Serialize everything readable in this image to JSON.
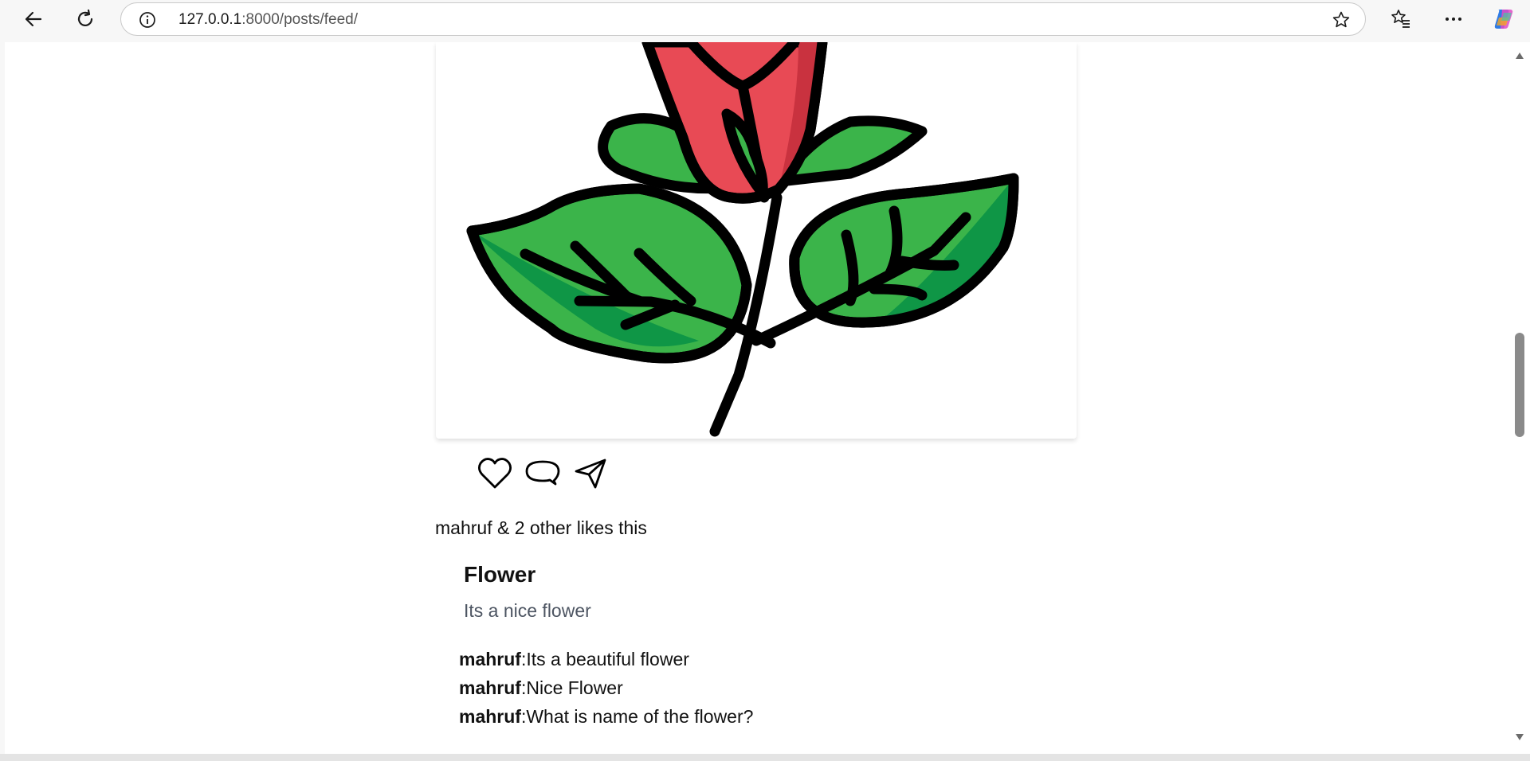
{
  "browser": {
    "url_host": "127.0.0.1",
    "url_rest": ":8000/posts/feed/",
    "icons": [
      "back-icon",
      "refresh-icon",
      "site-info-icon",
      "favorite-star-icon",
      "favorites-icon",
      "more-icon",
      "copilot-icon"
    ]
  },
  "post": {
    "image_alt": "rose-illustration",
    "likes_text": "mahruf & 2 other likes this",
    "title": "Flower",
    "description": "Its a nice flower",
    "comments": [
      {
        "user": "mahruf",
        "text": ":Its a beautiful flower"
      },
      {
        "user": "mahruf",
        "text": ":Nice Flower"
      },
      {
        "user": "mahruf",
        "text": ":What is name of the flower?"
      }
    ]
  },
  "colors": {
    "petal": "#e84a55",
    "petal_dark": "#c9323f",
    "leaf": "#3bb44a",
    "leaf_dark": "#0f9646",
    "outline": "#000000",
    "description_text": "#4d5562"
  }
}
